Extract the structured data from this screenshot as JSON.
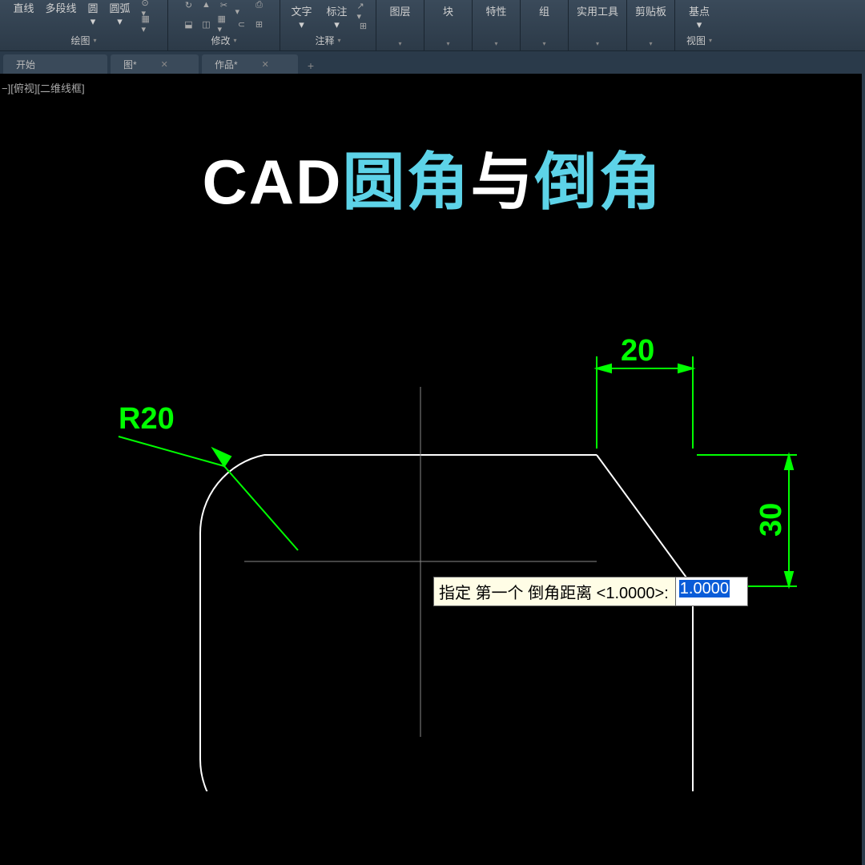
{
  "ribbon": {
    "panels": [
      {
        "buttons": [
          "直线",
          "多段线",
          "圆",
          "圆弧"
        ],
        "group": "绘图"
      },
      {
        "group": "修改"
      },
      {
        "buttons": [
          "文字",
          "标注"
        ],
        "group": "注释"
      },
      {
        "buttons": [
          "图层"
        ],
        "group": ""
      },
      {
        "buttons": [
          "块"
        ],
        "group": ""
      },
      {
        "buttons": [
          "特性"
        ],
        "group": ""
      },
      {
        "buttons": [
          "组"
        ],
        "group": ""
      },
      {
        "buttons": [
          "实用工具"
        ],
        "group": ""
      },
      {
        "buttons": [
          "剪贴板"
        ],
        "group": ""
      },
      {
        "buttons": [
          "基点"
        ],
        "group": "视图"
      }
    ]
  },
  "tabs": {
    "items": [
      {
        "label": "开始",
        "active": false
      },
      {
        "label": "图*",
        "active": false,
        "closable": true
      },
      {
        "label": "作品*",
        "active": true,
        "closable": true
      }
    ]
  },
  "viewport_label": "−][俯视][二维线框]",
  "title": {
    "part1": "CAD",
    "part2": "圆角",
    "part3": "与",
    "part4": "倒角"
  },
  "drawing": {
    "fillet_label": "R20",
    "dim_horizontal": "20",
    "dim_vertical": "30"
  },
  "command": {
    "prompt": "指定 第一个 倒角距离 <1.0000>:",
    "value": "1.0000"
  }
}
